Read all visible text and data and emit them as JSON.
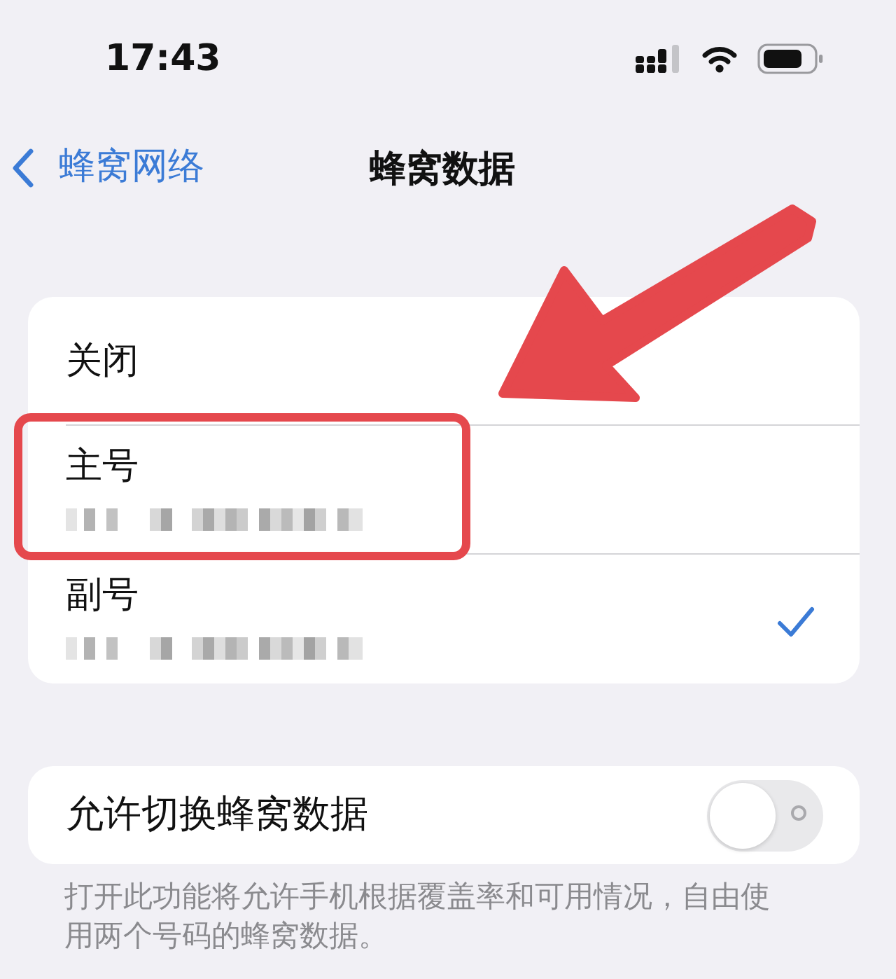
{
  "status_bar": {
    "time": "17:43"
  },
  "nav": {
    "back_label": "蜂窝网络",
    "title": "蜂窝数据"
  },
  "lines": [
    {
      "label": "关闭",
      "kind": "plain",
      "selected": false,
      "highlighted": false
    },
    {
      "label": "主号",
      "kind": "number",
      "selected": false,
      "highlighted": true
    },
    {
      "label": "副号",
      "kind": "number",
      "selected": true,
      "highlighted": false
    }
  ],
  "switching": {
    "label": "允许切换蜂窝数据",
    "on": false
  },
  "footer": "打开此功能将允许手机根据覆盖率和可用情况，自由使用两个号码的蜂窝数据。"
}
